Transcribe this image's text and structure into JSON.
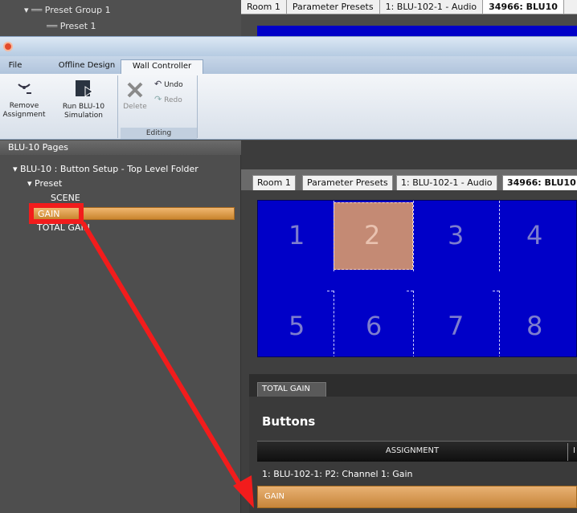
{
  "background_window": {
    "tree": [
      {
        "label": "Preset Group 1"
      },
      {
        "label": "Preset 1"
      }
    ],
    "tabs": [
      "Room 1",
      "Parameter Presets",
      "1: BLU-102-1 - Audio",
      "34966: BLU10"
    ]
  },
  "ribbon": {
    "tabs": [
      "File",
      "Offline Design",
      "Wall Controller"
    ],
    "active_tab": "Wall Controller",
    "buttons": {
      "remove_assignment": "Remove\nAssignment",
      "run_simulation": "Run BLU-10\nSimulation",
      "delete": "Delete",
      "undo": "Undo",
      "redo": "Redo"
    },
    "group_caption": "Editing"
  },
  "left_pane": {
    "header": "BLU-10 Pages",
    "root": "BLU-10 : Button Setup -  Top Level Folder",
    "child": "Preset",
    "items": [
      "SCENE",
      "GAIN",
      "TOTAL GAIN"
    ],
    "selected": "GAIN"
  },
  "document_tabs": [
    "Room 1",
    "Parameter Presets",
    "1: BLU-102-1 - Audio",
    "34966: BLU10"
  ],
  "button_grid": {
    "numbers": [
      "1",
      "2",
      "3",
      "4",
      "5",
      "6",
      "7",
      "8"
    ],
    "selected": "2"
  },
  "properties": {
    "tab": "TOTAL GAIN",
    "heading": "Buttons",
    "column_assignment": "ASSIGNMENT",
    "column_next": "I",
    "assignment_value": "1: BLU-102-1: P2: Channel 1: Gain",
    "field_value": "GAIN"
  },
  "colors": {
    "grid_blue": "#0000c8",
    "selection_orange": "#d99848",
    "annotation_red": "#f21c1c"
  }
}
